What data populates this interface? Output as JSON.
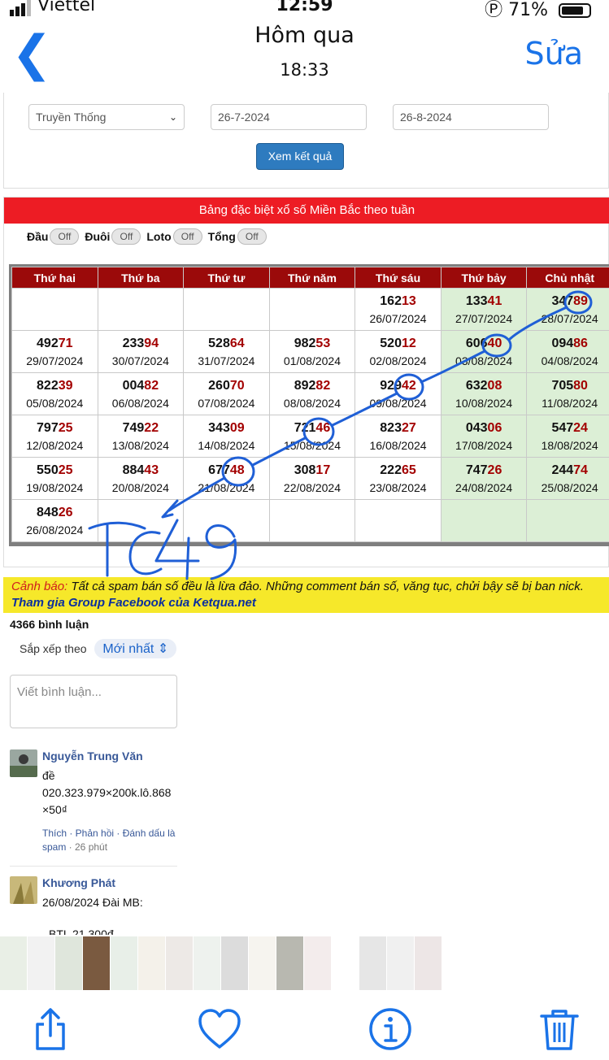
{
  "status_bar": {
    "carrier": "Viettel",
    "time": "12:59",
    "battery": "71%"
  },
  "nav": {
    "back_icon": "chevron-left-icon",
    "title": "Hôm qua",
    "subtitle": "18:33",
    "edit": "Sửa"
  },
  "form": {
    "selects": [
      "Truyền Thống",
      "26-7-2024",
      "26-8-2024"
    ],
    "button": "Xem kết quả"
  },
  "panel": {
    "title": "Bảng đặc biệt xổ số Miền Bắc theo tuần",
    "toggles": [
      {
        "label": "Đầu",
        "state": "Off"
      },
      {
        "label": "Đuôi",
        "state": "Off"
      },
      {
        "label": "Loto",
        "state": "Off"
      },
      {
        "label": "Tổng",
        "state": "Off"
      }
    ],
    "days": [
      "Thứ hai",
      "Thứ ba",
      "Thứ tư",
      "Thứ năm",
      "Thứ sáu",
      "Thứ bảy",
      "Chủ nhật"
    ],
    "rows": [
      [
        null,
        null,
        null,
        null,
        {
          "head": "162",
          "tail": "13",
          "date": "26/07/2024"
        },
        {
          "head": "133",
          "tail": "41",
          "date": "27/07/2024"
        },
        {
          "head": "347",
          "tail": "89",
          "date": "28/07/2024"
        }
      ],
      [
        {
          "head": "492",
          "tail": "71",
          "date": "29/07/2024"
        },
        {
          "head": "233",
          "tail": "94",
          "date": "30/07/2024"
        },
        {
          "head": "528",
          "tail": "64",
          "date": "31/07/2024"
        },
        {
          "head": "982",
          "tail": "53",
          "date": "01/08/2024"
        },
        {
          "head": "520",
          "tail": "12",
          "date": "02/08/2024"
        },
        {
          "head": "606",
          "tail": "40",
          "date": "03/08/2024"
        },
        {
          "head": "094",
          "tail": "86",
          "date": "04/08/2024"
        }
      ],
      [
        {
          "head": "822",
          "tail": "39",
          "date": "05/08/2024"
        },
        {
          "head": "004",
          "tail": "82",
          "date": "06/08/2024"
        },
        {
          "head": "260",
          "tail": "70",
          "date": "07/08/2024"
        },
        {
          "head": "892",
          "tail": "82",
          "date": "08/08/2024"
        },
        {
          "head": "929",
          "tail": "42",
          "date": "09/08/2024"
        },
        {
          "head": "632",
          "tail": "08",
          "date": "10/08/2024"
        },
        {
          "head": "705",
          "tail": "80",
          "date": "11/08/2024"
        }
      ],
      [
        {
          "head": "797",
          "tail": "25",
          "date": "12/08/2024"
        },
        {
          "head": "749",
          "tail": "22",
          "date": "13/08/2024"
        },
        {
          "head": "343",
          "tail": "09",
          "date": "14/08/2024"
        },
        {
          "head": "721",
          "tail": "46",
          "date": "15/08/2024"
        },
        {
          "head": "823",
          "tail": "27",
          "date": "16/08/2024"
        },
        {
          "head": "043",
          "tail": "06",
          "date": "17/08/2024"
        },
        {
          "head": "547",
          "tail": "24",
          "date": "18/08/2024"
        }
      ],
      [
        {
          "head": "550",
          "tail": "25",
          "date": "19/08/2024"
        },
        {
          "head": "884",
          "tail": "43",
          "date": "20/08/2024"
        },
        {
          "head": "677",
          "tail": "48",
          "date": "21/08/2024"
        },
        {
          "head": "308",
          "tail": "17",
          "date": "22/08/2024"
        },
        {
          "head": "222",
          "tail": "65",
          "date": "23/08/2024"
        },
        {
          "head": "747",
          "tail": "26",
          "date": "24/08/2024"
        },
        {
          "head": "244",
          "tail": "74",
          "date": "25/08/2024"
        }
      ],
      [
        {
          "head": "848",
          "tail": "26",
          "date": "26/08/2024"
        },
        null,
        null,
        null,
        null,
        null,
        null
      ]
    ]
  },
  "notice": {
    "warning_label": "Cảnh báo:",
    "warning_text": " Tất cả spam bán số đều là lừa đảo. Những comment bán số, văng tục, chửi bậy sẽ bị ban nick.",
    "link": "Tham gia Group Facebook của Ketqua.net"
  },
  "comments": {
    "count": "4366 bình luận",
    "sort_label": "Sắp xếp theo",
    "sort_value": "Mới nhất",
    "input_placeholder": "Viết bình luận...",
    "items": [
      {
        "name": "Nguyễn Trung Văn",
        "lines": [
          "đề",
          "020.323.979×200k.lô.868",
          "×50₫"
        ],
        "actions": "Thích · Phản hồi · Đánh dấu là spam",
        "time": " · 26 phút"
      },
      {
        "name": "Khương Phát",
        "lines": [
          "26/08/2024 Đài MB:"
        ],
        "actions": "",
        "time": ""
      }
    ],
    "cutoff_line": "BTL 21 300đ"
  },
  "toolbar": [
    "share-icon",
    "heart-icon",
    "info-icon",
    "trash-icon"
  ],
  "annotation": {
    "handwritten": "TC49",
    "ink_color": "#1f5fd6"
  }
}
